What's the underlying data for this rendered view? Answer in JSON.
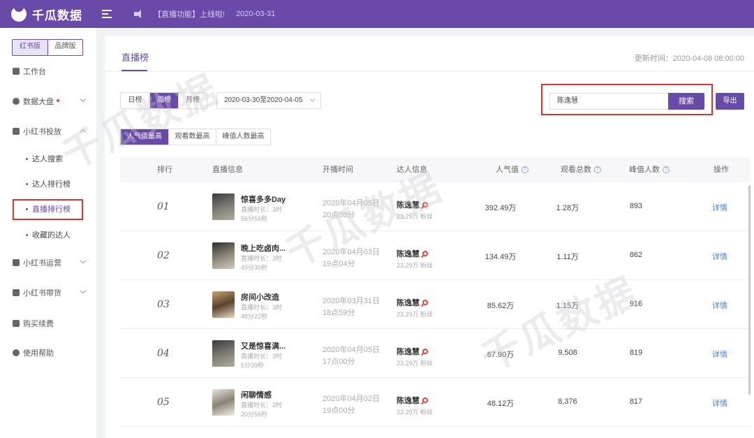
{
  "header": {
    "logo_text": "千瓜数据",
    "announcement": "【直播功能】上线啦!",
    "announcement_date": "2020-03-31"
  },
  "sidebar": {
    "versions": [
      "红书版",
      "品牌版"
    ],
    "items": [
      {
        "label": "工作台",
        "icon": "grid-icon"
      },
      {
        "label": "数据大盘",
        "icon": "pie-chart-icon"
      },
      {
        "label": "小红书投放",
        "icon": "cube-icon"
      },
      {
        "label": "小红书运营",
        "icon": "chat-icon"
      },
      {
        "label": "小红书带货",
        "icon": "shopping-bag-icon"
      },
      {
        "label": "购买续费",
        "icon": "cart-icon"
      },
      {
        "label": "使用帮助",
        "icon": "help-bubble-icon"
      }
    ],
    "sub_items": [
      "达人搜索",
      "达人排行榜",
      "直播排行榜",
      "收藏的达人"
    ]
  },
  "main": {
    "tab_title": "直播榜",
    "update_time": "更新时间：2020-04-08 08:00:00",
    "period_tabs": [
      "日榜",
      "周榜",
      "月榜"
    ],
    "date_range": "2020-03-30至2020-04-05",
    "search_value": "陈逸慧",
    "search_button": "搜索",
    "export_button": "导出",
    "sort_tabs": [
      "人气值最高",
      "观看数最高",
      "峰值人数最高"
    ],
    "columns": [
      "排行",
      "直播信息",
      "开播时间",
      "达人信息",
      "人气值",
      "观看总数",
      "峰值人数",
      "操作"
    ],
    "rows": [
      {
        "rank": "01",
        "title": "惊喜多多Day",
        "duration": "直播时长：3时56分56秒",
        "date": "2020年04月05日",
        "time": "20点08分",
        "kol": "陈逸慧",
        "fans": "23.29万 粉丝",
        "popularity": "392.49万",
        "views": "1.28万",
        "peak": "893",
        "action": "详情"
      },
      {
        "rank": "02",
        "title": "晚上吃卤肉...",
        "duration": "直播时长：3时49分30秒",
        "date": "2020年04月03日",
        "time": "19点04分",
        "kol": "陈逸慧",
        "fans": "23.29万 粉丝",
        "popularity": "134.49万",
        "views": "1.11万",
        "peak": "862",
        "action": "详情"
      },
      {
        "rank": "03",
        "title": "房间小改造",
        "duration": "直播时长：3时48分22秒",
        "date": "2020年03月31日",
        "time": "18点59分",
        "kol": "陈逸慧",
        "fans": "23.29万 粉丝",
        "popularity": "85.62万",
        "views": "1.15万",
        "peak": "916",
        "action": "详情"
      },
      {
        "rank": "04",
        "title": "又是惊喜满...",
        "duration": "直播时长：3时5分39秒",
        "date": "2020年04月05日",
        "time": "17点00分",
        "kol": "陈逸慧",
        "fans": "23.29万 粉丝",
        "popularity": "67.90万",
        "views": "9,508",
        "peak": "819",
        "action": "详情"
      },
      {
        "rank": "05",
        "title": "闲聊情感",
        "duration": "直播时长：2时20分56秒",
        "date": "2020年04月02日",
        "time": "19点00分",
        "kol": "陈逸慧",
        "fans": "23.29万 粉丝",
        "popularity": "48.12万",
        "views": "8,376",
        "peak": "817",
        "action": "详情"
      }
    ]
  },
  "colors": {
    "brand": "#6a4aa8",
    "highlight_box": "#d9362f",
    "link": "#4a7ed8"
  }
}
